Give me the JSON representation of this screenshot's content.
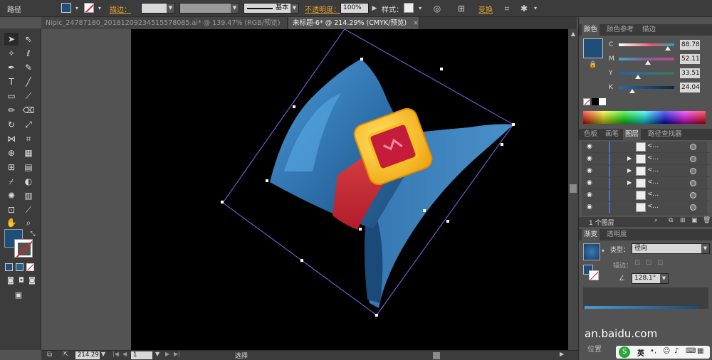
{
  "control_bar": {
    "selection_label": "路径",
    "stroke_label": "描边：",
    "opacity_label": "不透明度：",
    "opacity_value": "100%",
    "style_label": "样式：",
    "transform_label": "变换",
    "brush_value": "基本",
    "fill_color": "#1f4e79"
  },
  "tabs": [
    {
      "label": "Nipic_24787180_20181209234515578085.ai* @ 139.47% (RGB/预览)"
    },
    {
      "label": "未标题-6* @ 214.29% (CMYK/预览)"
    }
  ],
  "color_panel": {
    "tabs": [
      "颜色",
      "颜色参考",
      "描边"
    ],
    "swatch_color": "#1f4e79",
    "channels": [
      {
        "name": "C",
        "value": "88.78",
        "level": 0.89,
        "color": "#e05a6a"
      },
      {
        "name": "M",
        "value": "52.11",
        "level": 0.52,
        "color": "#c04a88"
      },
      {
        "name": "Y",
        "value": "33.51",
        "level": 0.34,
        "color": "#2e6e8e"
      },
      {
        "name": "K",
        "value": "24.04",
        "level": 0.24,
        "color": "#1f4e79"
      }
    ]
  },
  "layers_panel": {
    "tabs": [
      "色板",
      "画笔",
      "图层",
      "路径查找器"
    ],
    "rows": [
      {
        "name": "<..."
      },
      {
        "name": "<..."
      },
      {
        "name": "<..."
      },
      {
        "name": "<..."
      },
      {
        "name": "<..."
      },
      {
        "name": "<..."
      }
    ],
    "footer": "1 个图层"
  },
  "gradient_panel": {
    "tabs": [
      "渐变",
      "透明度"
    ],
    "type_label": "类型：",
    "type_value": "径向",
    "stroke_label": "描边：",
    "angle_value": "128.1°",
    "position_label": "位置"
  },
  "status_bar": {
    "zoom": "214.29",
    "artboard": "1",
    "tool": "选择"
  },
  "watermark": {
    "text": "an.baidu.com",
    "ime": "英"
  }
}
